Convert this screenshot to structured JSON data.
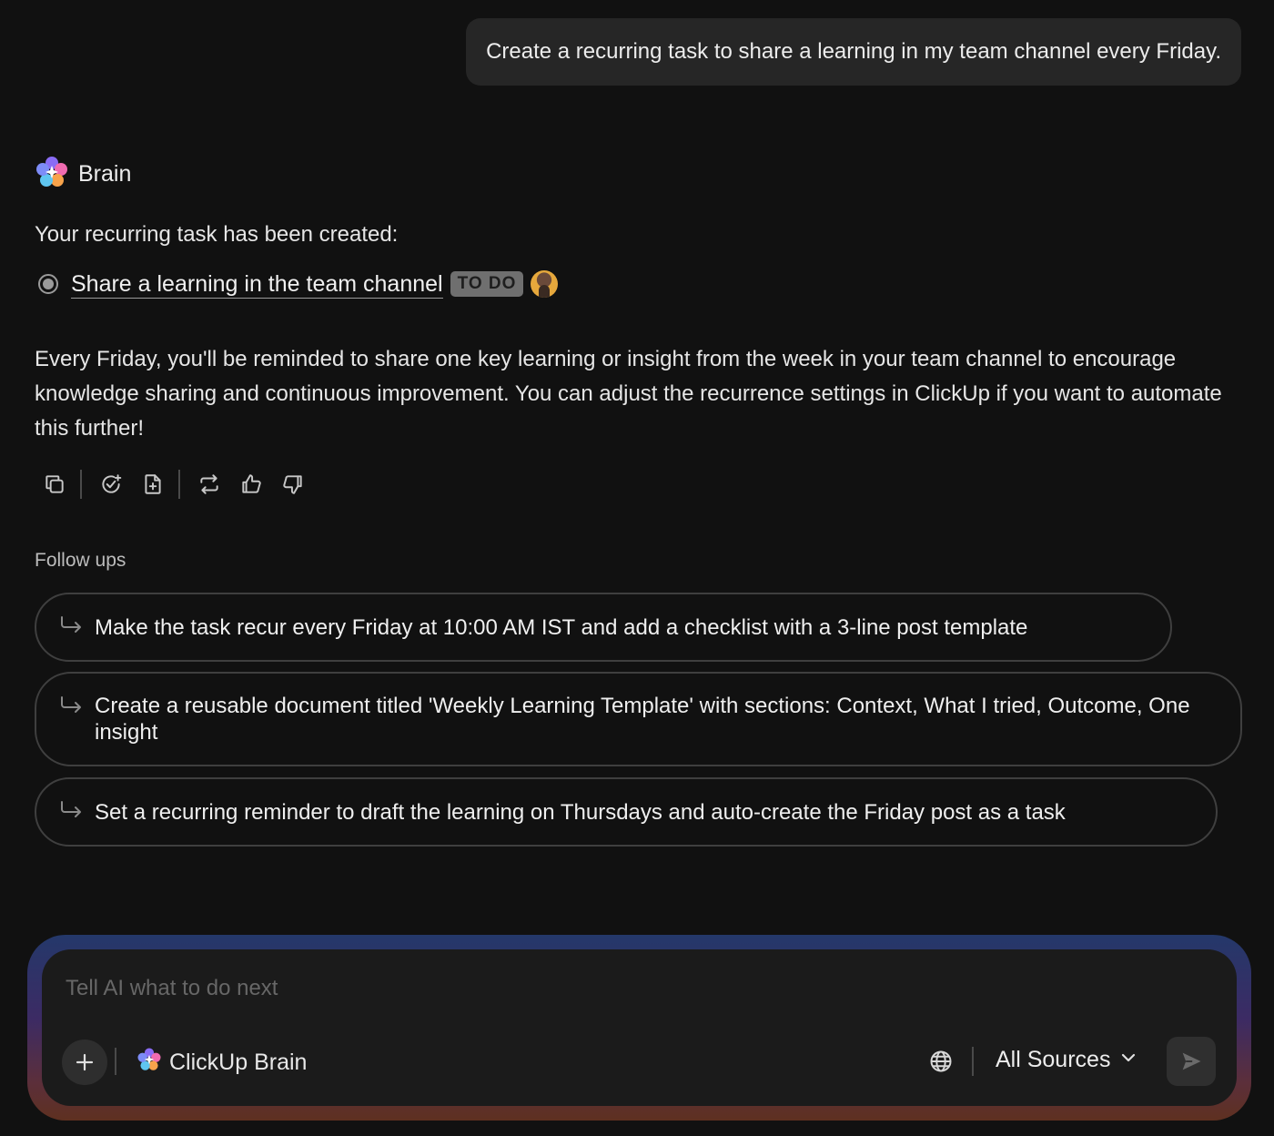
{
  "user_message": "Create a recurring task to share a learning in my team channel every Friday.",
  "assistant": {
    "name": "Brain",
    "intro": "Your recurring task has been created:",
    "task": {
      "name": "Share a learning in the team channel",
      "status": "TO DO",
      "status_color": "#6f6f6f"
    },
    "body": "Every Friday, you'll be reminded to share one key learning or insight from the week in your team channel to encourage knowledge sharing and continuous improvement. You can adjust the recurrence settings in ClickUp if you want to automate this further!",
    "actions": [
      "copy-icon",
      "create-task-icon",
      "add-doc-icon",
      "regenerate-icon",
      "thumbs-up-icon",
      "thumbs-down-icon"
    ]
  },
  "follow_ups": {
    "label": "Follow ups",
    "items": [
      "Make the task recur every Friday at 10:00 AM IST and add a checklist with a 3-line post template",
      "Create a reusable document titled 'Weekly Learning Template' with sections: Context, What I tried, Outcome, One insight",
      "Set a recurring reminder to draft the learning on Thursdays and auto-create the Friday post as a task"
    ]
  },
  "composer": {
    "placeholder": "Tell AI what to do next",
    "agent_label": "ClickUp Brain",
    "sources_label": "All Sources"
  }
}
